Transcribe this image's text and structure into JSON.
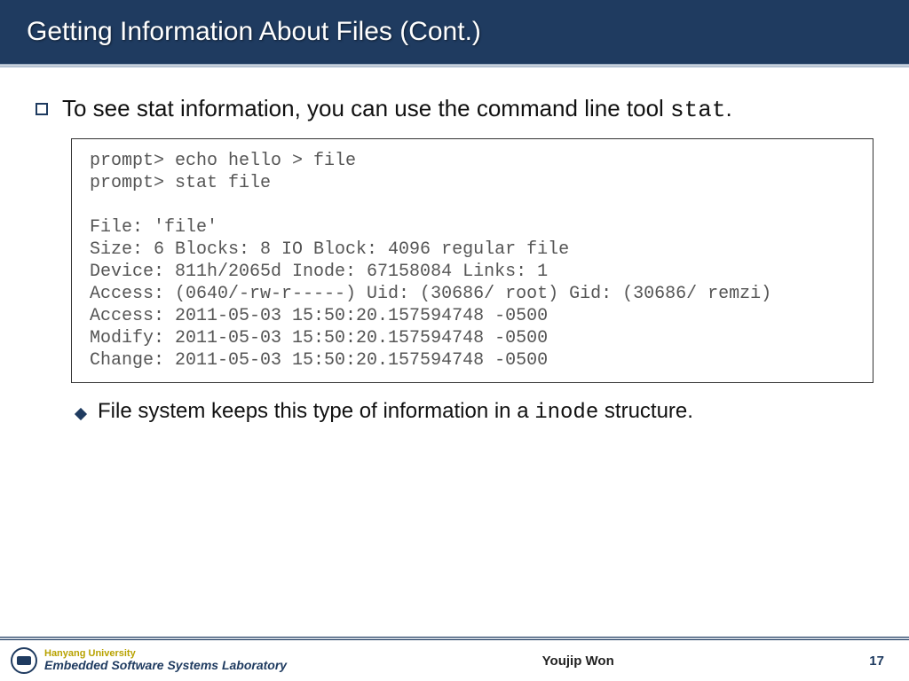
{
  "title": "Getting Information About Files (Cont.)",
  "bullet1": {
    "pre": "To see stat information, you can use the command line tool ",
    "code": "stat",
    "post": "."
  },
  "code_block": "prompt> echo hello > file\nprompt> stat file\n\nFile: 'file'\nSize: 6 Blocks: 8 IO Block: 4096 regular file\nDevice: 811h/2065d Inode: 67158084 Links: 1\nAccess: (0640/-rw-r-----) Uid: (30686/ root) Gid: (30686/ remzi)\nAccess: 2011-05-03 15:50:20.157594748 -0500\nModify: 2011-05-03 15:50:20.157594748 -0500\nChange: 2011-05-03 15:50:20.157594748 -0500",
  "sub1": {
    "pre": "File system keeps this type of information in a ",
    "code": "inode",
    "post": " structure."
  },
  "footer": {
    "university": "Hanyang University",
    "lab": "Embedded Software Systems Laboratory",
    "author": "Youjip Won",
    "page": "17"
  }
}
